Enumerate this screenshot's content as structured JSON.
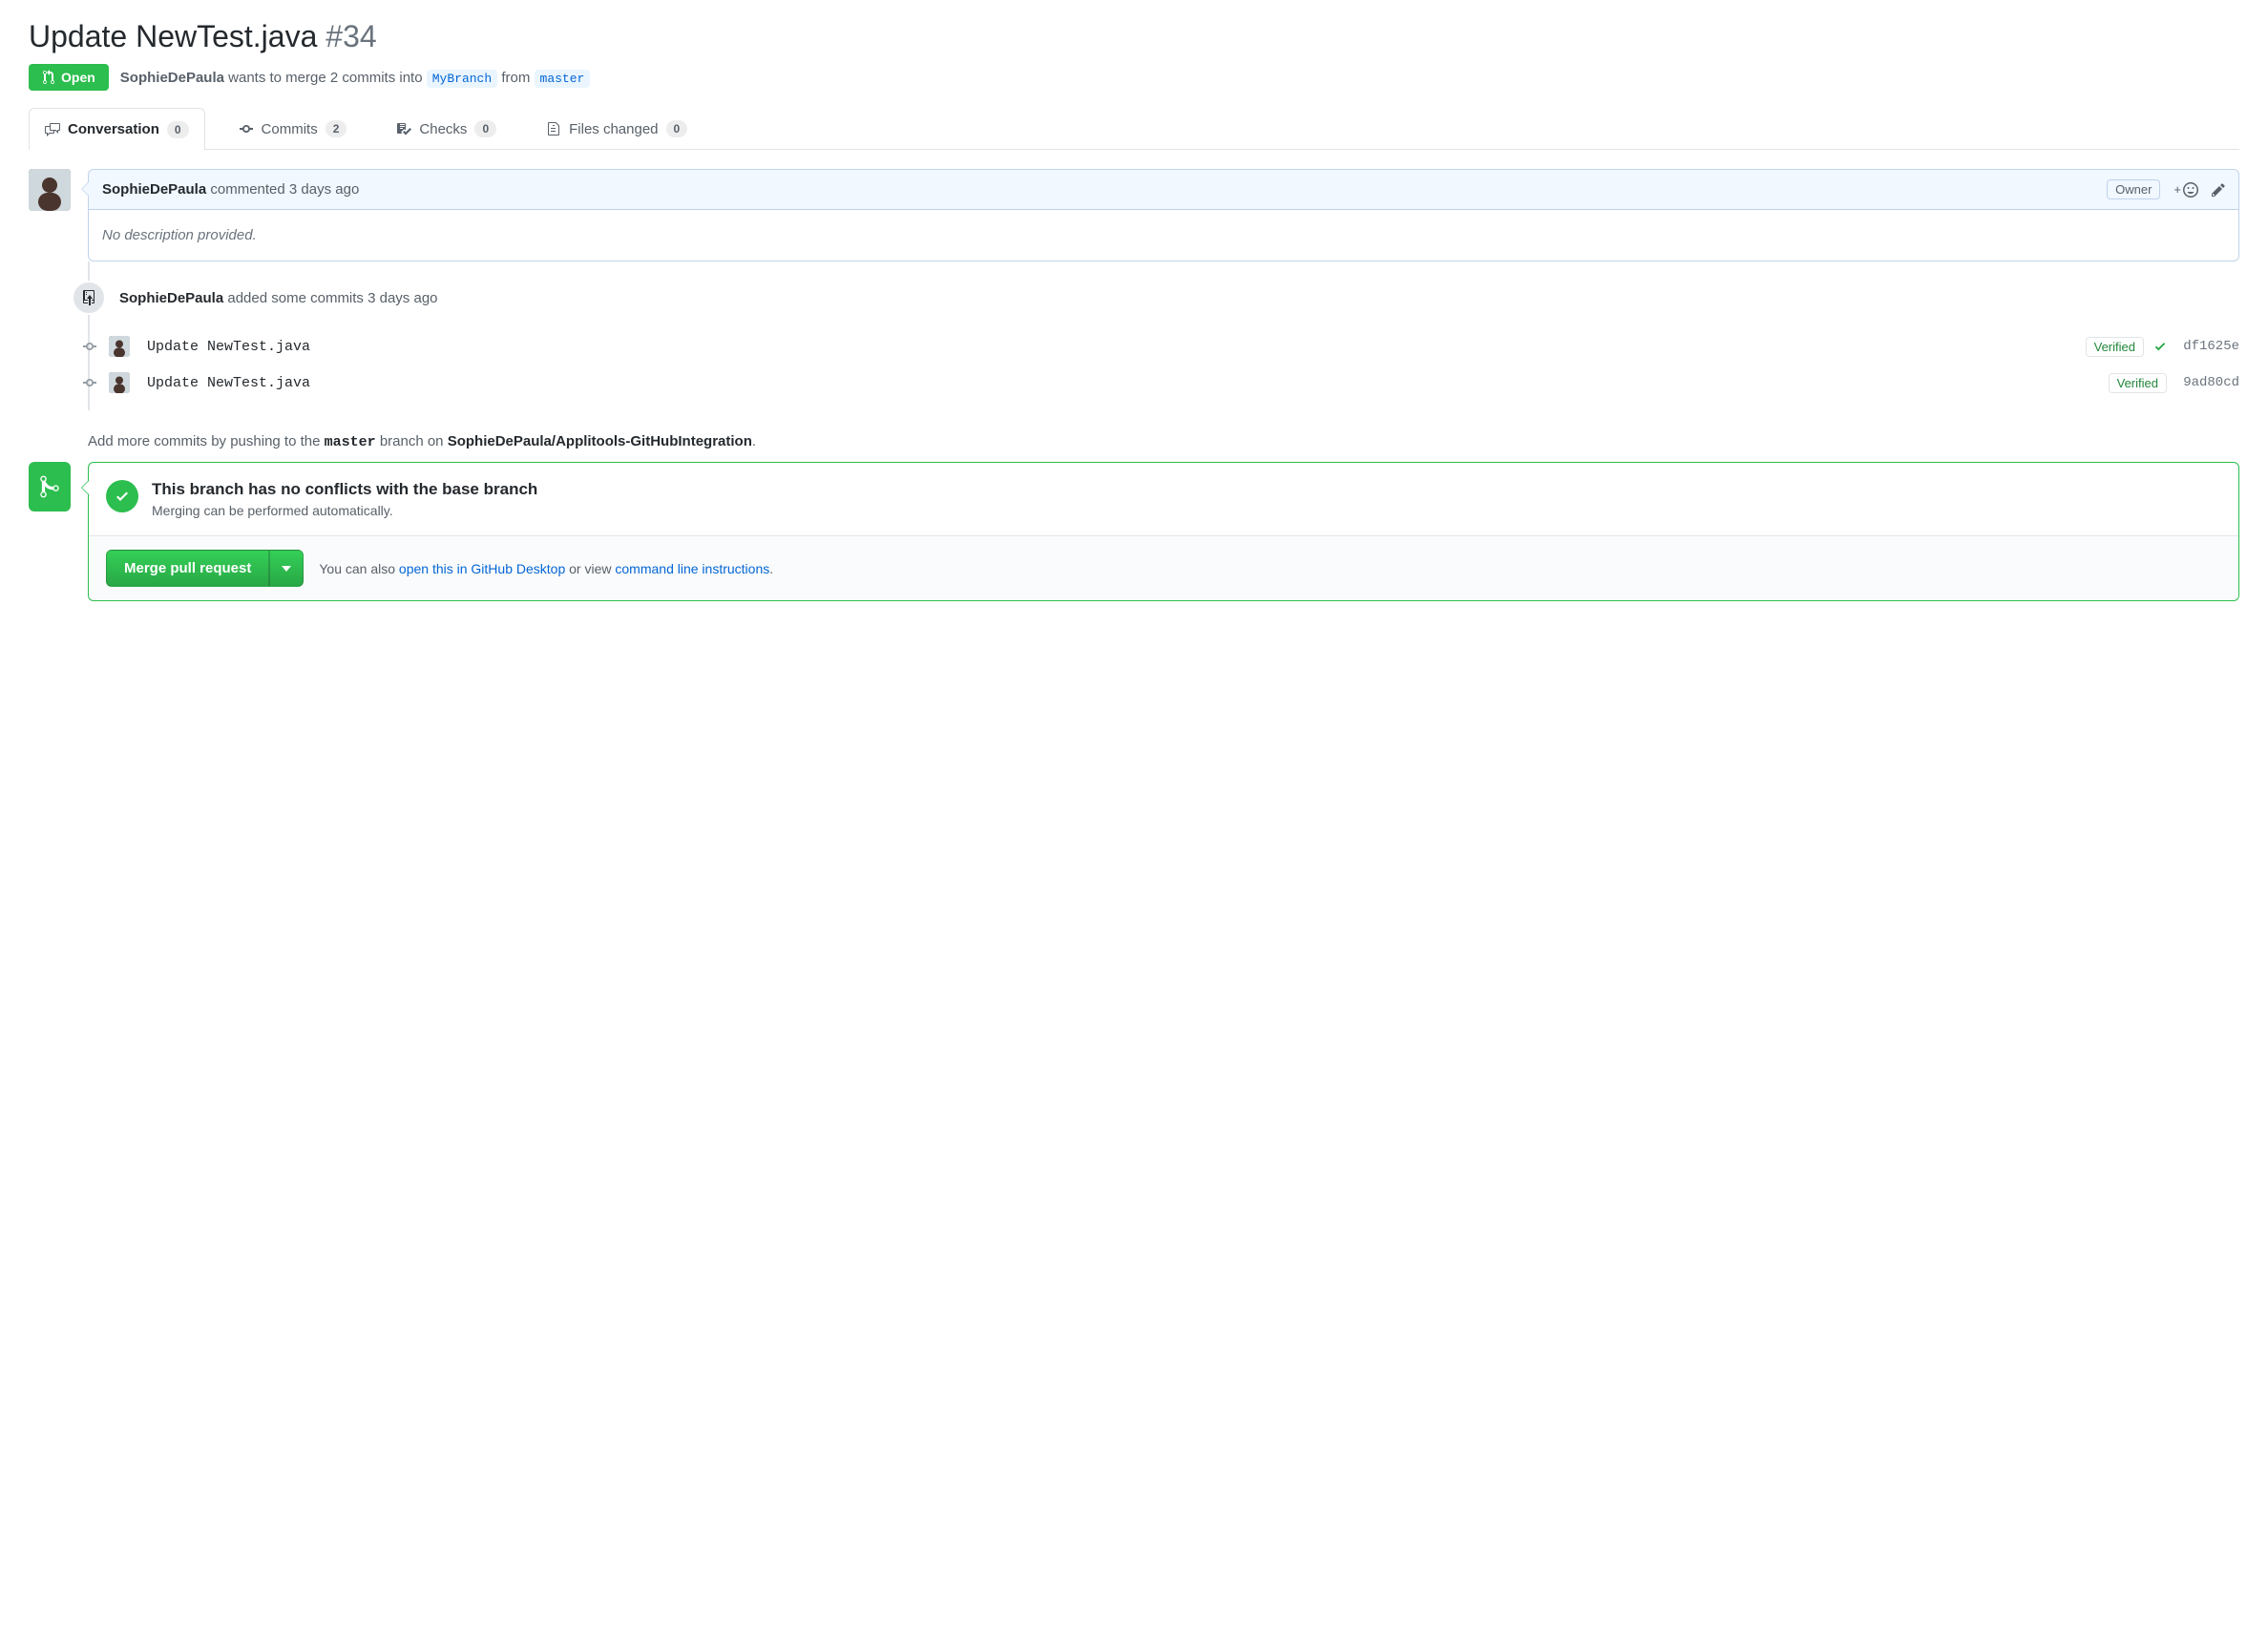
{
  "pr": {
    "title": "Update NewTest.java",
    "number": "#34",
    "state": "Open",
    "author": "SophieDePaula",
    "merge_text_prefix": "wants to merge 2 commits into",
    "base_branch": "MyBranch",
    "from_word": "from",
    "head_branch": "master"
  },
  "tabs": {
    "conversation": {
      "label": "Conversation",
      "count": "0"
    },
    "commits": {
      "label": "Commits",
      "count": "2"
    },
    "checks": {
      "label": "Checks",
      "count": "0"
    },
    "files": {
      "label": "Files changed",
      "count": "0"
    }
  },
  "comment": {
    "author": "SophieDePaula",
    "action": "commented",
    "time": "3 days ago",
    "owner_label": "Owner",
    "body": "No description provided."
  },
  "commits_event": {
    "author": "SophieDePaula",
    "text": "added some commits",
    "time": "3 days ago"
  },
  "commits": [
    {
      "message": "Update NewTest.java",
      "verified": "Verified",
      "sha": "df1625e",
      "has_check": true
    },
    {
      "message": "Update NewTest.java",
      "verified": "Verified",
      "sha": "9ad80cd",
      "has_check": false
    }
  ],
  "hint": {
    "prefix": "Add more commits by pushing to the",
    "branch": "master",
    "mid": "branch on",
    "repo": "SophieDePaula/Applitools-GitHubIntegration",
    "suffix": "."
  },
  "merge": {
    "title": "This branch has no conflicts with the base branch",
    "subtitle": "Merging can be performed automatically.",
    "button": "Merge pull request",
    "side_prefix": "You can also",
    "desktop_link": "open this in GitHub Desktop",
    "side_mid": "or view",
    "cli_link": "command line instructions",
    "side_suffix": "."
  }
}
